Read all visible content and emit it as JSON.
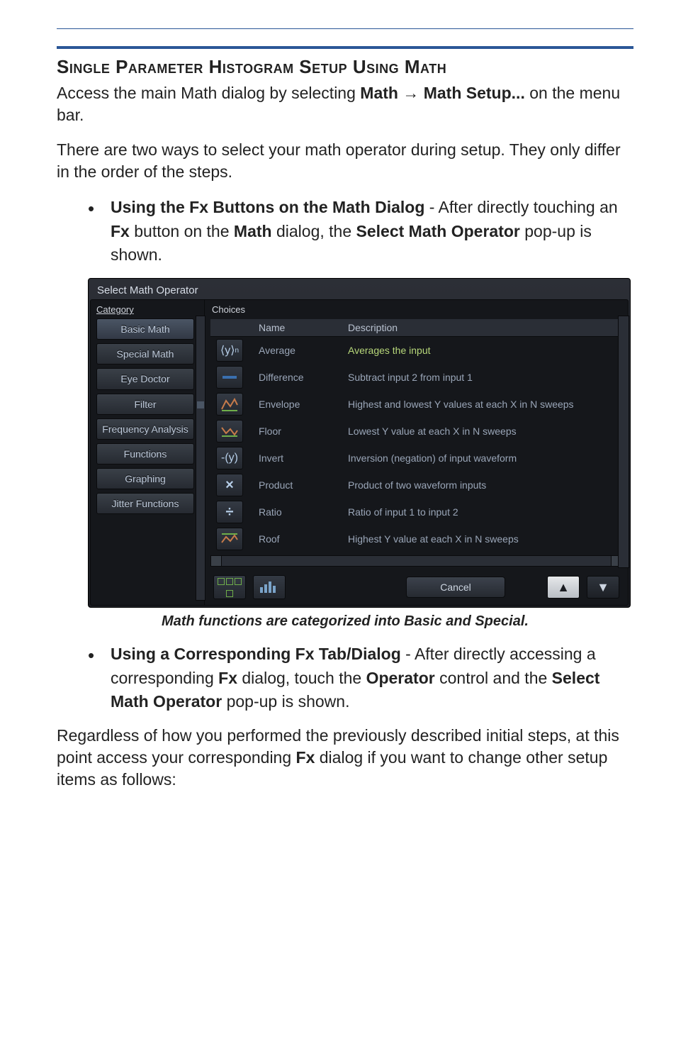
{
  "heading": "Single Parameter Histogram Setup Using Math",
  "para1_a": "Access the main Math dialog by selecting ",
  "para1_b": "Math → Math Setup...",
  "para1_c": " on the menu bar.",
  "para2": "There are two ways to select your math operator during setup. They only differ in the order of the steps.",
  "bullet1_lead": "Using the Fx Buttons on the Math Dialog",
  "bullet1_rest": " - After directly touching an ",
  "bullet1_fx": "Fx",
  "bullet1_mid": " button on the ",
  "bullet1_math": "Math",
  "bullet1_mid2": " dialog, the ",
  "bullet1_smo": "Select Math Operator",
  "bullet1_end": " pop-up is shown.",
  "dialog": {
    "title": "Select Math Operator",
    "category_label": "Category",
    "choices_label": "Choices",
    "categories": [
      "Basic Math",
      "Special Math",
      "Eye Doctor",
      "Filter",
      "Frequency Analysis",
      "Functions",
      "Graphing",
      "Jitter Functions"
    ],
    "headers": {
      "name": "Name",
      "desc": "Description"
    },
    "rows": [
      {
        "icon": "avg",
        "name": "Average",
        "desc": "Averages the input"
      },
      {
        "icon": "diff",
        "name": "Difference",
        "desc": "Subtract input 2 from input 1"
      },
      {
        "icon": "env",
        "name": "Envelope",
        "desc": "Highest and lowest Y values at each X in N sweeps"
      },
      {
        "icon": "floor",
        "name": "Floor",
        "desc": "Lowest Y value at each X in N sweeps"
      },
      {
        "icon": "inv",
        "name": "Invert",
        "desc": "Inversion (negation) of input waveform"
      },
      {
        "icon": "prod",
        "name": "Product",
        "desc": "Product of two waveform inputs"
      },
      {
        "icon": "ratio",
        "name": "Ratio",
        "desc": "Ratio of input 1 to input 2"
      },
      {
        "icon": "roof",
        "name": "Roof",
        "desc": "Highest Y value at each X in N sweeps"
      }
    ],
    "cancel": "Cancel"
  },
  "caption": "Math functions are categorized into Basic and Special.",
  "bullet2_lead": "Using a Corresponding Fx Tab/Dialog",
  "bullet2_rest": " - After directly accessing a corresponding ",
  "bullet2_fx": "Fx",
  "bullet2_mid": " dialog, touch the ",
  "bullet2_op": "Operator",
  "bullet2_mid2": " control and the ",
  "bullet2_smo": "Select Math Operator",
  "bullet2_end": " pop-up is shown.",
  "para3_a": "Regardless of how you performed the previously described initial steps, at this point access your corresponding ",
  "para3_fx": "Fx",
  "para3_b": " dialog if you want to change other setup items as follows:"
}
